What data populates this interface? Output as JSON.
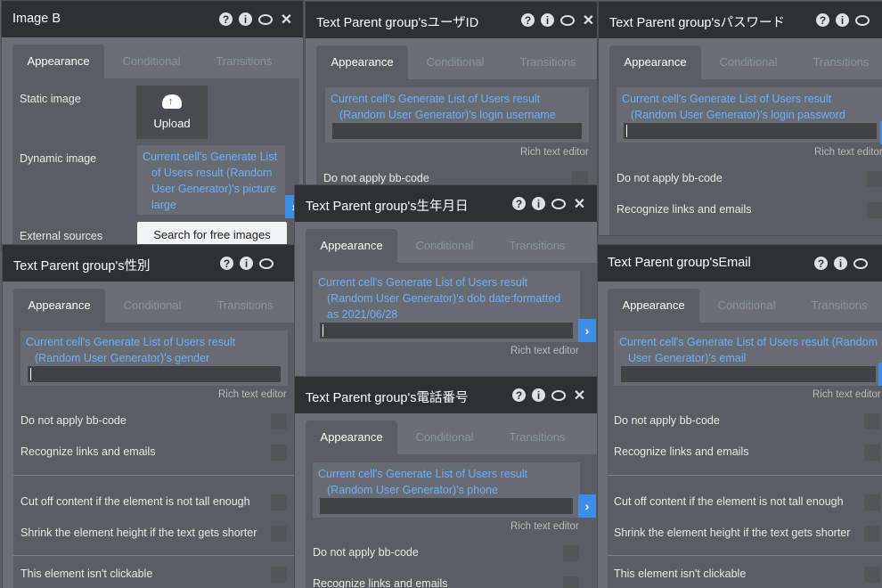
{
  "common": {
    "tabs": [
      "Appearance",
      "Conditional",
      "Transitions"
    ],
    "rich_text_editor": "Rich text editor",
    "do_not_apply_bbcode": "Do not apply bb-code",
    "recognize_links": "Recognize links and emails",
    "cut_off": "Cut off content if the element is not tall enough",
    "shrink": "Shrink the element height if the text gets shorter",
    "not_clickable": "This element isn't clickable",
    "icons": [
      "help-icon",
      "info-icon",
      "comment-icon",
      "close-icon"
    ]
  },
  "panel_image": {
    "title": "Image B",
    "static_image_label": "Static image",
    "upload_label": "Upload",
    "dynamic_image_label": "Dynamic image",
    "dynamic_image_expr": "Current cell's Generate List of Users result (Random User Generator)'s picture large",
    "external_sources_label": "External sources",
    "search_button": "Search for free images"
  },
  "panel_userid": {
    "title": "Text Parent group'sユーザID",
    "expr": "Current cell's Generate List of Users result (Random User Generator)'s login username"
  },
  "panel_password": {
    "title": "Text Parent group'sパスワード",
    "expr": "Current cell's Generate List of Users result (Random User Generator)'s login password"
  },
  "panel_gender": {
    "title": "Text Parent group's性別",
    "expr": "Current cell's Generate List of Users result (Random User Generator)'s gender"
  },
  "panel_birthday": {
    "title": "Text Parent group's生年月日",
    "expr": "Current cell's Generate List of Users result (Random User Generator)'s dob date:formatted as 2021/06/28"
  },
  "panel_phone": {
    "title": "Text Parent group's電話番号",
    "expr": "Current cell's Generate List of Users result (Random User Generator)'s phone"
  },
  "panel_email": {
    "title": "Text Parent group'sEmail",
    "expr": "Current cell's Generate List of Users result (Random User Generator)'s email"
  },
  "colors": {
    "header_bg": "#2d3136",
    "panel_bg": "#6b6f75",
    "expression_text": "#6ab0ff",
    "accent": "#3e8de8"
  }
}
